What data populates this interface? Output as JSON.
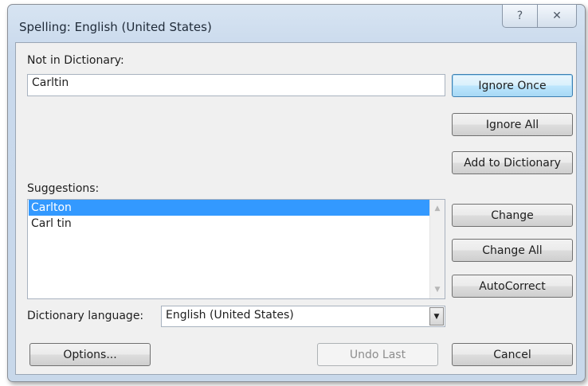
{
  "window": {
    "title": "Spelling: English (United States)",
    "help_glyph": "?",
    "close_glyph": "✕"
  },
  "not_in_dictionary": {
    "label": "Not in Dictionary:",
    "value": "Carltin"
  },
  "suggestions": {
    "label": "Suggestions:",
    "items": [
      "Carlton",
      "Carl tin"
    ],
    "selected_index": 0
  },
  "dictionary_language": {
    "label": "Dictionary language:",
    "value": "English (United States)"
  },
  "buttons": {
    "ignore_once": "Ignore Once",
    "ignore_all": "Ignore All",
    "add_to_dictionary": "Add to Dictionary",
    "change": "Change",
    "change_all": "Change All",
    "autocorrect": "AutoCorrect",
    "options": "Options...",
    "undo_last": "Undo Last",
    "cancel": "Cancel"
  },
  "colors": {
    "selection": "#3399ff",
    "default_button_border": "#3c7fb1"
  }
}
